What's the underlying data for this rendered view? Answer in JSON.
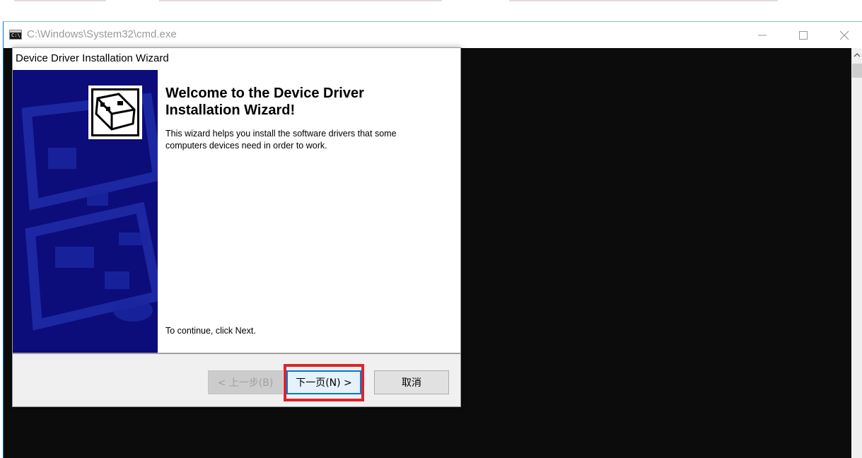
{
  "cmd_window": {
    "title": "C:\\Windows\\System32\\cmd.exe",
    "icon_text": "C:\\.",
    "icon": "cmd-icon",
    "minimize_icon": "minimize-icon",
    "maximize_icon": "maximize-icon",
    "close_icon": "close-icon"
  },
  "wizard": {
    "title": "Device Driver Installation Wizard",
    "heading": "Welcome to the Device Driver Installation Wizard!",
    "description": "This wizard helps you install the software drivers that some computers devices need in order to work.",
    "continue_text": "To continue, click Next.",
    "sidebar_icon": "device-driver-icon",
    "buttons": {
      "back": "< 上一步(B)",
      "next": "下一页(N) >",
      "cancel": "取消"
    }
  },
  "colors": {
    "sidebar": "#0c0c7a",
    "console": "#0c0c0c",
    "highlight": "#d9262c",
    "focus": "#0078d7"
  }
}
